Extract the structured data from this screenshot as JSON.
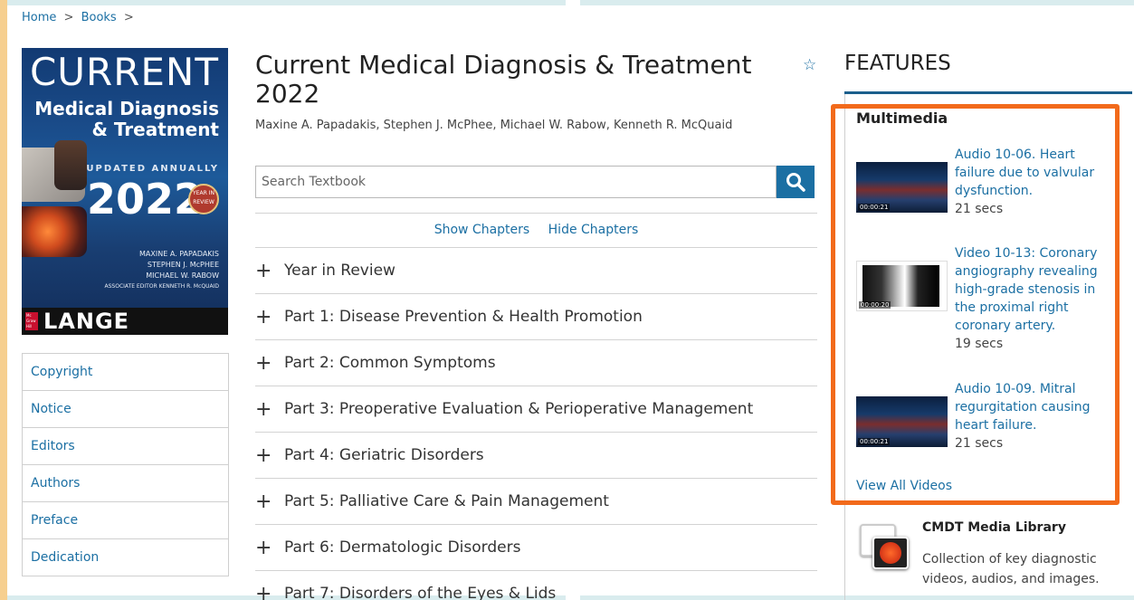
{
  "breadcrumb": {
    "home": "Home",
    "books": "Books",
    "sep": ">"
  },
  "cover": {
    "line1": "CURRENT",
    "line2": "Medical Diagnosis",
    "line3": "& Treatment",
    "updated": "UPDATED ANNUALLY",
    "year": "2022",
    "badge": "YEAR IN REVIEW",
    "author1": "MAXINE A. PAPADAKIS",
    "author2": "STEPHEN J. McPHEE",
    "author3": "MICHAEL W. RABOW",
    "associate": "ASSOCIATE EDITOR KENNETH R. McQUAID",
    "publisher": "LANGE",
    "mg": "Mc Graw Hill"
  },
  "leftnav": [
    {
      "label": "Copyright"
    },
    {
      "label": "Notice"
    },
    {
      "label": "Editors"
    },
    {
      "label": "Authors"
    },
    {
      "label": "Preface"
    },
    {
      "label": "Dedication"
    }
  ],
  "book": {
    "title": "Current Medical Diagnosis & Treatment 2022",
    "authors": "Maxine A. Papadakis, Stephen J. McPhee, Michael W. Rabow, Kenneth R. McQuaid"
  },
  "search": {
    "placeholder": "Search Textbook"
  },
  "chapters": {
    "show": "Show Chapters",
    "hide": "Hide Chapters",
    "items": [
      {
        "label": "Year in Review"
      },
      {
        "label": "Part 1: Disease Prevention & Health Promotion"
      },
      {
        "label": "Part 2: Common Symptoms"
      },
      {
        "label": "Part 3: Preoperative Evaluation & Perioperative Management"
      },
      {
        "label": "Part 4: Geriatric Disorders"
      },
      {
        "label": "Part 5: Palliative Care & Pain Management"
      },
      {
        "label": "Part 6: Dermatologic Disorders"
      },
      {
        "label": "Part 7: Disorders of the Eyes & Lids"
      }
    ]
  },
  "features": {
    "title": "FEATURES",
    "multimedia": {
      "title": "Multimedia",
      "items": [
        {
          "title": "Audio 10-06. Heart failure due to valvular dysfunction.",
          "duration": "21 secs",
          "timestamp": "00:00:21",
          "kind": "audio"
        },
        {
          "title": "Video 10-13: Coronary angiography revealing high-grade stenosis in the proximal right coronary artery.",
          "duration": "19 secs",
          "timestamp": "00:00:20",
          "kind": "video"
        },
        {
          "title": "Audio 10-09. Mitral regurgitation causing heart failure.",
          "duration": "21 secs",
          "timestamp": "00:00:21",
          "kind": "audio"
        }
      ],
      "view_all": "View All Videos"
    },
    "library": {
      "title": "CMDT Media Library",
      "desc": "Collection of key diagnostic videos, audios, and images."
    }
  },
  "colors": {
    "link": "#1b6fa3",
    "highlight": "#f26a1b",
    "side_bg": "#f6cf8f"
  }
}
